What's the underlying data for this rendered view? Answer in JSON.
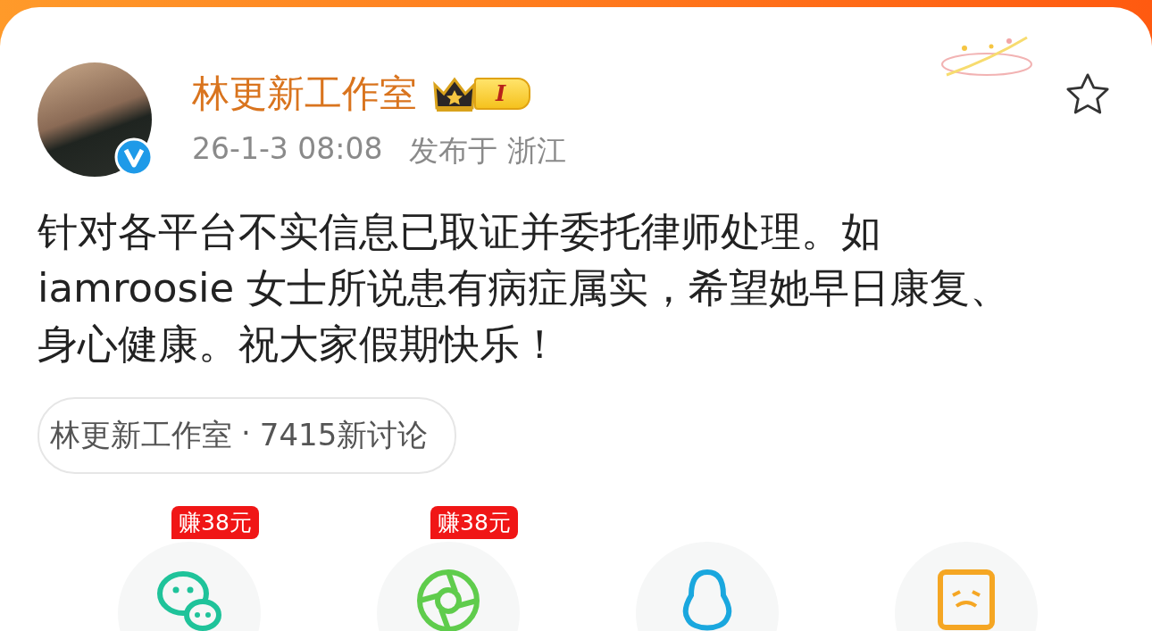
{
  "post": {
    "author": "林更新工作室",
    "author_verified": true,
    "rank_badge": "I",
    "time": "26-1-3 08:08",
    "location": "发布于 浙江",
    "favorited": false,
    "text": "针对各平台不实信息已取证并委托律师处理。如iamroosie 女士所说患有病症属实，希望她早日康复、身心健康。祝大家假期快乐！",
    "topic": {
      "name": "林更新工作室",
      "separator": "·",
      "count": "7415新讨论"
    }
  },
  "share_options": [
    {
      "kind": "wechat",
      "badge": "赚38元"
    },
    {
      "kind": "moments",
      "badge": "赚38元"
    },
    {
      "kind": "qq"
    },
    {
      "kind": "qzone"
    }
  ]
}
